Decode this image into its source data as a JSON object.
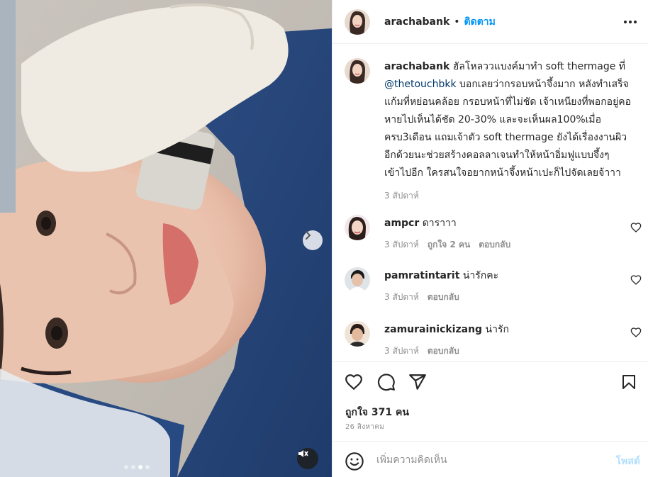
{
  "post": {
    "author": "arachabank",
    "separator": "•",
    "follow_label": "ติดตาม",
    "caption": {
      "username": "arachabank",
      "text_part1": " ฮัลโหลววแบงค์มาทำ soft thermage ที่ ",
      "mention": "@thetouchbkk",
      "text_part2": " บอกเลยว่ากรอบหน้าจึ้งมาก หลังทำเสร็จแก้มที่หย่อนคล้อย กรอบหน้าที่ไม่ชัด เจ้าเหนียงที่พอกอยู่คอ หายไปเห็นได้ชัด 20-30% และจะเห็นผล100%เมื่อครบ3เดือน แถมเจ้าตัว soft thermage ยังได้เรื่องงานผิวอีกด้วยนะช่วยสร้างคอลลาเจนทำให้หน้าอิ่มฟูแบบจึ้งๆเข้าไปอีก ใครสนใจอยากหน้าจึ้งหน้าเปะก็ไปจัดเลยจ้าาา",
      "time": "3 สัปดาห์"
    },
    "comments": [
      {
        "username": "ampcr",
        "text": "ดาราาา",
        "time": "3 สัปดาห์",
        "likes": "ถูกใจ 2 คน",
        "reply": "ตอบกลับ"
      },
      {
        "username": "pamratintarit",
        "text": "น่ารักคะ",
        "time": "3 สัปดาห์",
        "reply": "ตอบกลับ"
      },
      {
        "username": "zamurainickizang",
        "text": "น่ารัก",
        "time": "3 สัปดาห์",
        "reply": "ตอบกลับ"
      }
    ],
    "likes_text": "ถูกใจ 371 คน",
    "date": "26 สิงหาคม",
    "composer": {
      "placeholder": "เพิ่มความคิดเห็น",
      "post_label": "โพสต์"
    },
    "carousel": {
      "count": 4,
      "active_index": 2
    },
    "colors": {
      "accent": "#0095f6",
      "mention": "#00376b",
      "muted": "#8e8e8e",
      "post_disabled": "#b2dffc"
    },
    "icons": [
      "more-icon",
      "heart-icon",
      "comment-icon",
      "share-icon",
      "save-icon",
      "emoji-icon",
      "chevron-right-icon",
      "mute-icon"
    ]
  }
}
